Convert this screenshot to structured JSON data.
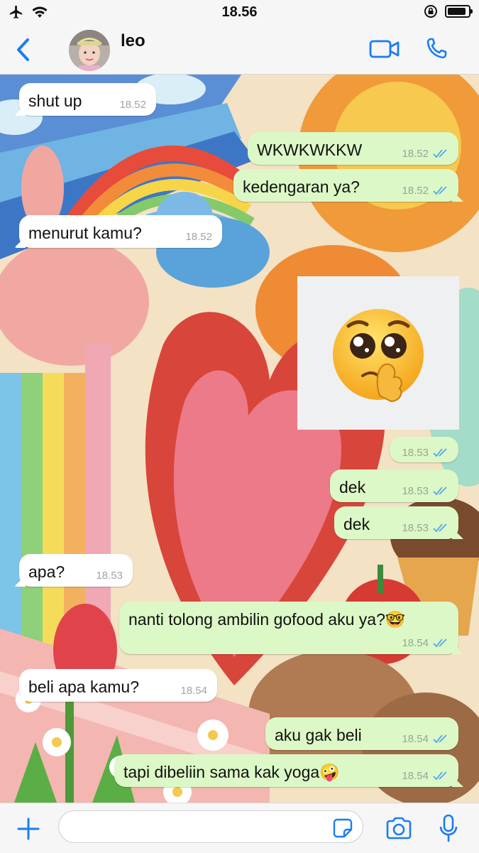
{
  "status_bar": {
    "time": "18.56"
  },
  "header": {
    "contact_name": "leo"
  },
  "messages": [
    {
      "dir": "in",
      "text": "shut up",
      "time": "18.52"
    },
    {
      "dir": "out",
      "text": "WKWKWKKW",
      "time": "18.52"
    },
    {
      "dir": "out",
      "text": "kedengaran ya?",
      "time": "18.52"
    },
    {
      "dir": "in",
      "text": "menurut kamu?",
      "time": "18.52"
    },
    {
      "dir": "out",
      "text": "",
      "time": "18.53",
      "sticker": "pleading-face-sticker"
    },
    {
      "dir": "out",
      "text": "dek",
      "time": "18.53"
    },
    {
      "dir": "out",
      "text": "dek",
      "time": "18.53"
    },
    {
      "dir": "in",
      "text": "apa?",
      "time": "18.53"
    },
    {
      "dir": "out",
      "text": "nanti tolong ambilin gofood aku ya?🤓",
      "time": "18.54"
    },
    {
      "dir": "in",
      "text": "beli apa kamu?",
      "time": "18.54"
    },
    {
      "dir": "out",
      "text": "aku gak beli",
      "time": "18.54"
    },
    {
      "dir": "out",
      "text": "tapi dibeliin sama kak yoga🤪",
      "time": "18.54"
    }
  ],
  "input": {
    "placeholder": ""
  },
  "colors": {
    "accent": "#1a7cf5",
    "outgoing_bubble": "#dcf8c6",
    "incoming_bubble": "#ffffff",
    "read_ticks": "#4fa6f0"
  },
  "icons": [
    "airplane-icon",
    "wifi-icon",
    "lock-rotation-icon",
    "battery-icon",
    "back-chevron-icon",
    "video-call-icon",
    "phone-icon",
    "plus-icon",
    "sticker-icon",
    "camera-icon",
    "microphone-icon",
    "read-ticks-icon"
  ]
}
